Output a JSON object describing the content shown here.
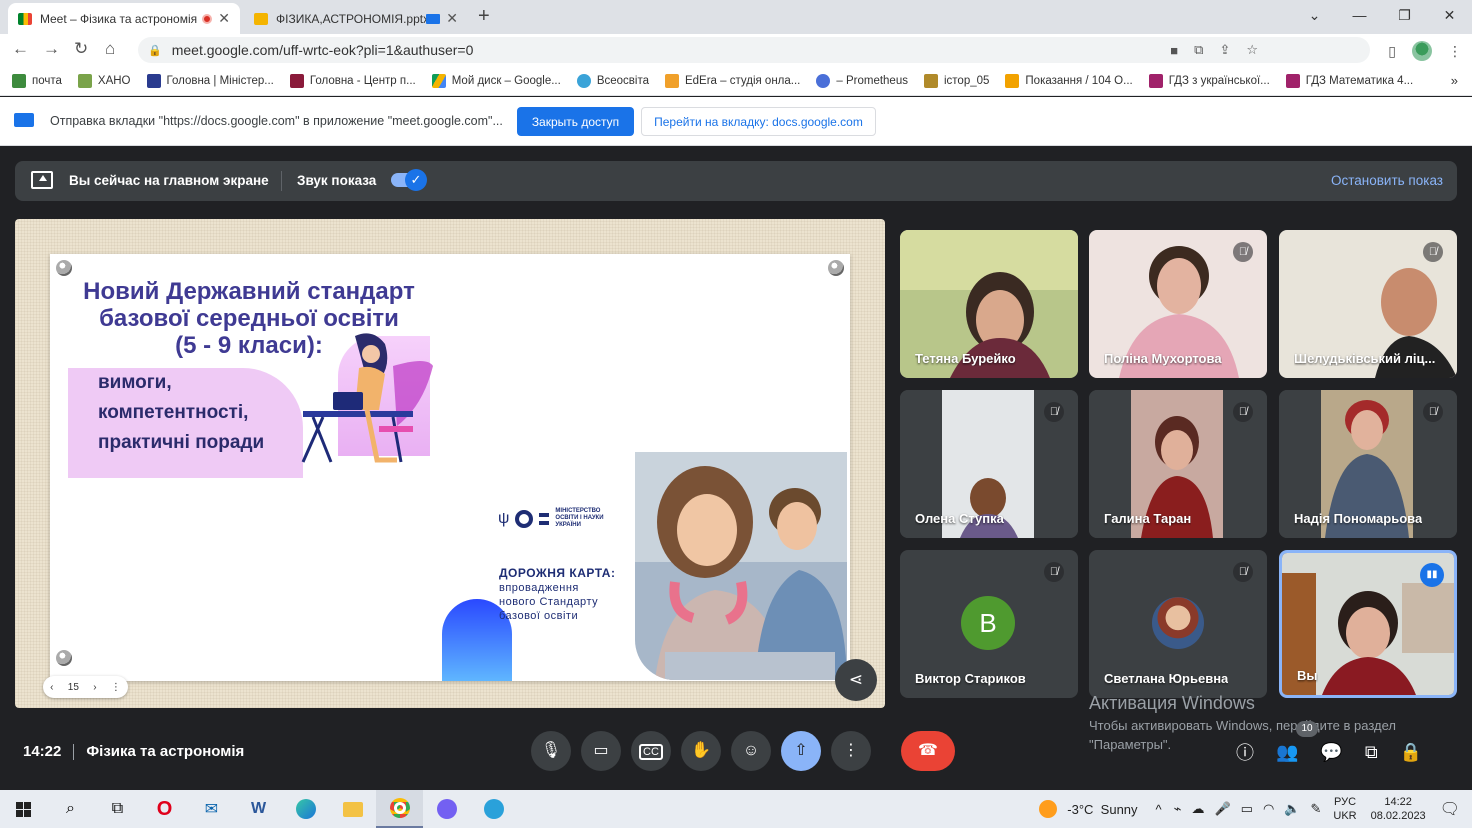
{
  "browser": {
    "tabs": [
      {
        "title": "Meet – Фізика та астрономія",
        "active": true
      },
      {
        "title": "ФІЗИКА,АСТРОНОМІЯ.pptx",
        "active": false
      }
    ],
    "url": "meet.google.com/uff-wrtc-eok?pli=1&authuser=0",
    "bookmarks": [
      "почта",
      "ХАНО",
      "Головна | Міністер...",
      "Головна - Центр п...",
      "Мой диск – Google...",
      "Всеосвіта",
      "EdEra – студія онла...",
      "– Prometheus",
      "істор_05",
      "Показання / 104 О...",
      "ГДЗ з української...",
      "ГДЗ Математика 4..."
    ],
    "bookmarks_more": "»",
    "infobar": {
      "text": "Отправка вкладки \"https://docs.google.com\" в приложение \"meet.google.com\"...",
      "primary_button": "Закрыть доступ",
      "secondary_button": "Перейти на вкладку: docs.google.com"
    }
  },
  "meet": {
    "present_bar": {
      "status": "Вы сейчас на главном экране",
      "sound_label": "Звук показа",
      "stop_button": "Остановить показ"
    },
    "slide": {
      "title_lines": [
        "Новий Державний стандарт",
        "базової середньої освіти",
        "(5 - 9 класи):"
      ],
      "subtitle_lines": [
        "вимоги,",
        "компетентності,",
        "практичні поради"
      ],
      "ministry_text": [
        "МІНІСТЕРСТВО",
        "ОСВІТИ І НАУКИ",
        "УКРАЇНИ"
      ],
      "roadmap_title": "ДОРОЖНЯ КАРТА:",
      "roadmap_lines": [
        "впровадження",
        "нового Стандарту",
        "базової освіти"
      ],
      "page_number": "15"
    },
    "participants": [
      {
        "name": "Тетяна Бурейко",
        "muted": false
      },
      {
        "name": "Поліна Мухортова",
        "muted": true
      },
      {
        "name": "Шелудьківський ліц...",
        "muted": true
      },
      {
        "name": "Олена Ступка",
        "muted": true
      },
      {
        "name": "Галина Таран",
        "muted": true
      },
      {
        "name": "Надія Пономарьова",
        "muted": true
      },
      {
        "name": "Виктор Стариков",
        "muted": true,
        "initial": "B"
      },
      {
        "name": "Светлана Юрьевна",
        "muted": true
      },
      {
        "name": "Вы",
        "muted": false
      }
    ],
    "activation": {
      "title": "Активация Windows",
      "line1": "Чтобы активировать Windows, перейдите в раздел",
      "line2": "\"Параметры\"."
    },
    "time": "14:22",
    "meeting_name": "Фізика та астрономія",
    "participants_count": "10"
  },
  "taskbar": {
    "weather": "-3°C  Sunny",
    "lang_top": "РУС",
    "lang_bottom": "UKR",
    "clock_time": "14:22",
    "clock_date": "08.02.2023"
  },
  "colors": {
    "meet_bg": "#202124",
    "accent_blue": "#1a73e8",
    "end_call_red": "#ea4335",
    "slide_title": "#3f3a93"
  }
}
